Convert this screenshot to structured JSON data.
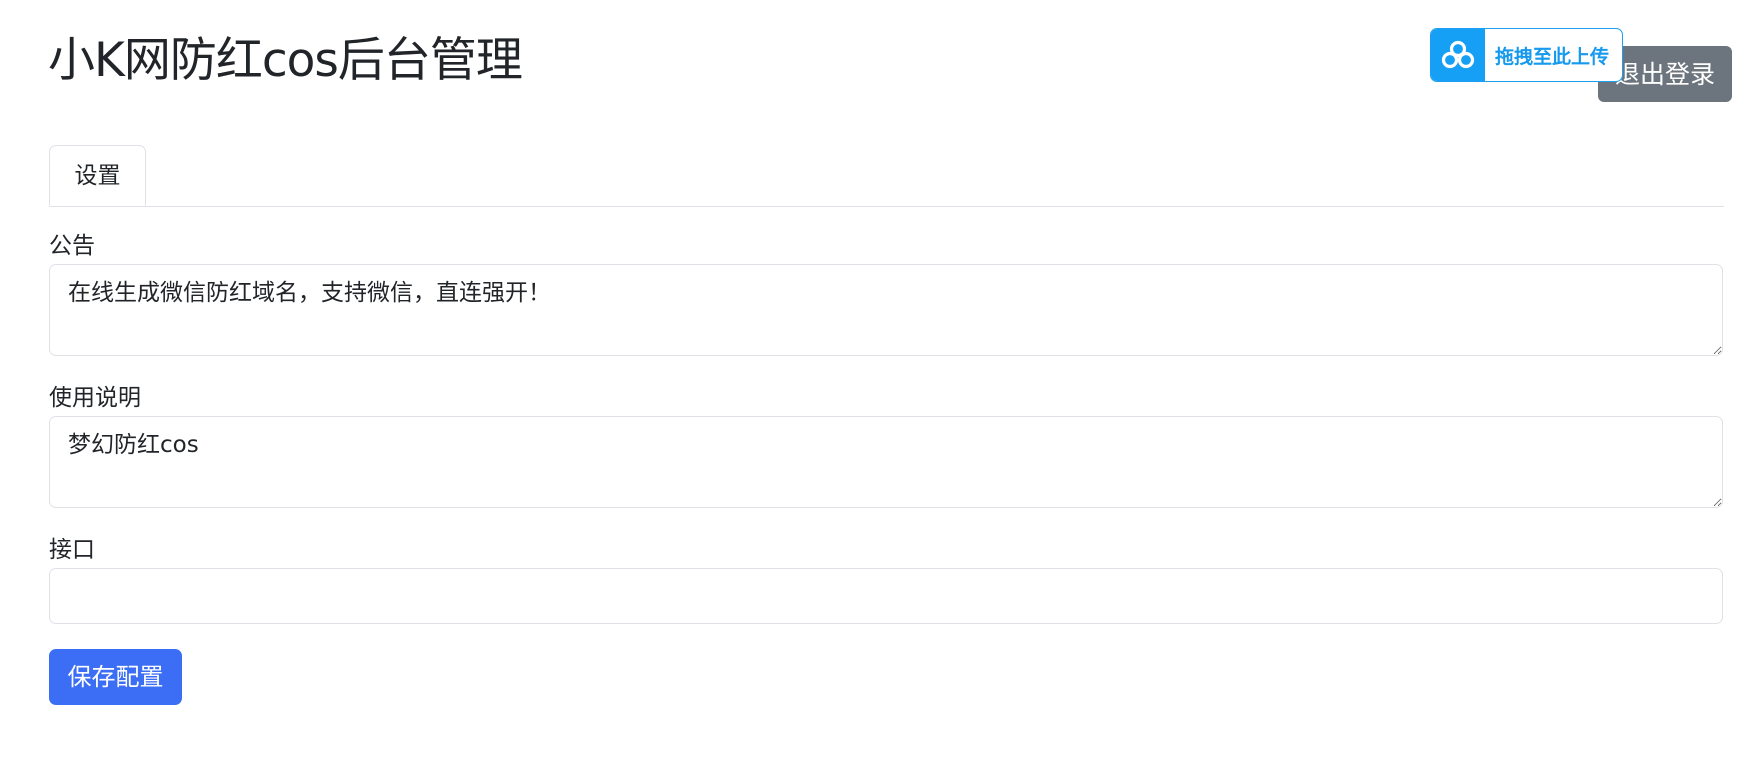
{
  "header": {
    "title": "小K网防红cos后台管理",
    "logout_label": "退出登录"
  },
  "upload_widget": {
    "label": "拖拽至此上传",
    "icon": "cloud-upload-icon",
    "color": "#15a0f5"
  },
  "tabs": [
    {
      "label": "设置",
      "active": true
    }
  ],
  "form": {
    "announcement": {
      "label": "公告",
      "value": "在线生成微信防红域名，支持微信，直连强开！"
    },
    "instructions": {
      "label": "使用说明",
      "value": "梦幻防红cos"
    },
    "api": {
      "label": "接口",
      "value": ""
    },
    "save_label": "保存配置"
  },
  "colors": {
    "primary": "#3b6ef5",
    "secondary": "#6c757d",
    "border": "#dee2e6"
  }
}
